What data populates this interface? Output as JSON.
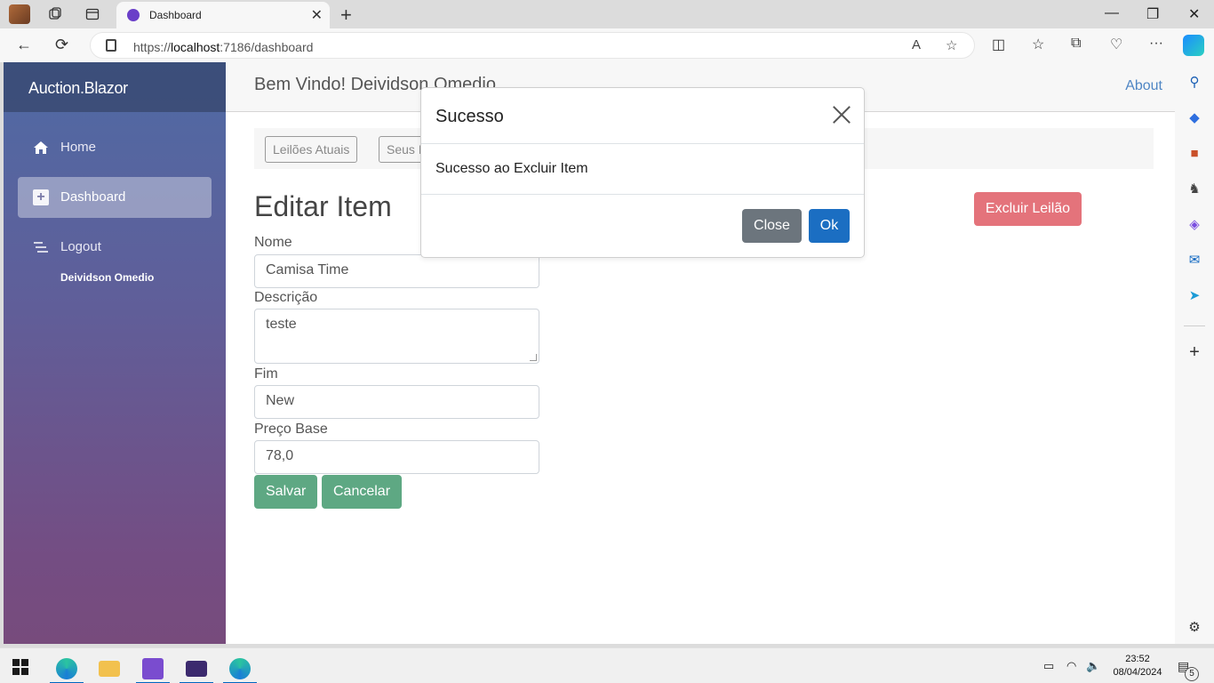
{
  "browser": {
    "tab_title": "Dashboard",
    "url_prefix": "https://",
    "url_host": "localhost",
    "url_rest": ":7186/dashboard"
  },
  "sidebar": {
    "brand": "Auction.Blazor",
    "items": [
      {
        "label": "Home",
        "icon": "home-icon"
      },
      {
        "label": "Dashboard",
        "icon": "plus-icon",
        "active": true
      },
      {
        "label": "Logout",
        "icon": "list-icon"
      }
    ],
    "user_name": "Deividson Omedio"
  },
  "topbar": {
    "welcome": "Bem Vindo! Deividson Omedio",
    "about": "About"
  },
  "tabs": [
    "Leilões Atuais",
    "Seus Itens"
  ],
  "form": {
    "title": "Editar Item",
    "nome_label": "Nome",
    "nome_value": "Camisa Time",
    "descricao_label": "Descrição",
    "descricao_value": "teste",
    "fim_label": "Fim",
    "fim_value": "New",
    "preco_label": "Preço Base",
    "preco_value": "78,0",
    "save_label": "Salvar",
    "cancel_label": "Cancelar",
    "delete_label": "Excluir Leilão"
  },
  "modal": {
    "title": "Sucesso",
    "body": "Sucesso ao Excluir Item",
    "close_label": "Close",
    "ok_label": "Ok"
  },
  "taskbar": {
    "time": "23:52",
    "date": "08/04/2024",
    "notification_count": "5"
  },
  "colors": {
    "sidebar_top": "#4f6aa4",
    "sidebar_bottom": "#774b7c",
    "green_button": "#5ea883",
    "delete_button": "#e4737b",
    "ok_button": "#1b6ec2",
    "close_button": "#6c757d",
    "about_link": "#4f86c4"
  }
}
